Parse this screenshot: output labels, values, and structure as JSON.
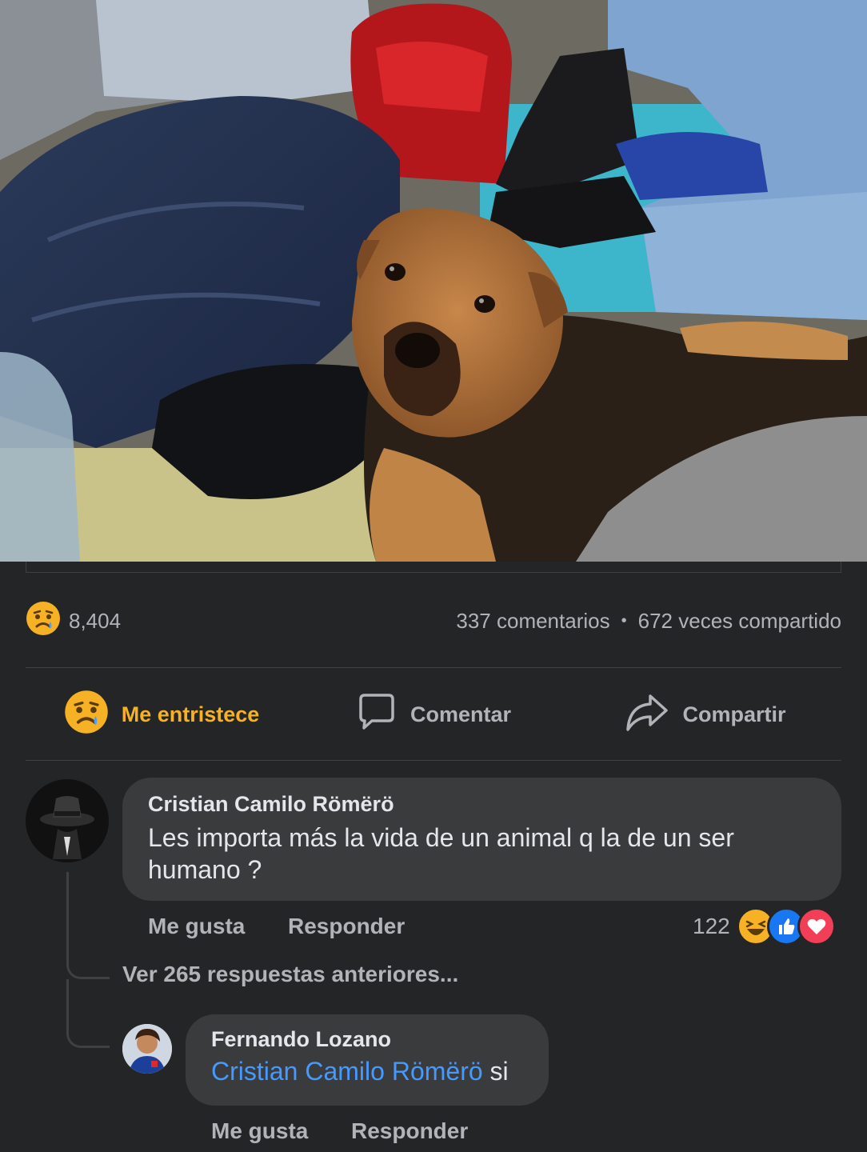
{
  "post": {
    "photo_alt": "Perro",
    "reaction_icon": "sad-reaction-icon",
    "reaction_count": "8,404",
    "comments_count": "337 comentarios",
    "separator": "•",
    "shares_count": "672 veces compartido"
  },
  "actions": {
    "reaction_label": "Me entristece",
    "reaction_color": "#f7b125",
    "comment_label": "Comentar",
    "share_label": "Compartir"
  },
  "comments": [
    {
      "author": "Cristian Camilo Römërö",
      "text": "Les importa más la vida de un animal q la de un ser humano ?",
      "like_label": "Me gusta",
      "reply_label": "Responder",
      "reaction_count": "122",
      "reaction_icons": [
        "haha-icon",
        "like-icon",
        "love-icon"
      ]
    }
  ],
  "thread": {
    "view_more_label": "Ver 265 respuestas anteriores..."
  },
  "reply": {
    "author": "Fernando Lozano",
    "mention": "Cristian Camilo Römërö",
    "text": "si",
    "like_label": "Me gusta",
    "reply_label": "Responder"
  },
  "colors": {
    "background": "#242526",
    "bubble": "#3a3b3c",
    "mention": "#4599ff",
    "secondary_text": "#b0b3b8"
  }
}
